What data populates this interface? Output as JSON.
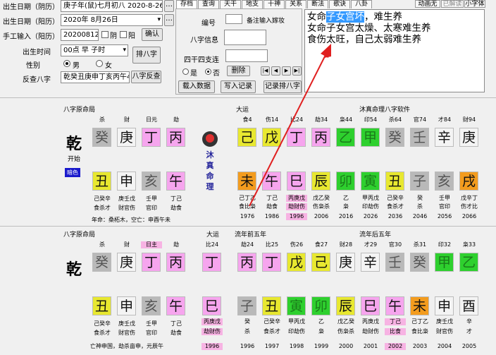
{
  "top_left": {
    "date1": {
      "label": "出生日期（阴历）",
      "value": "庚子年(鼠)七月初八 2020-8-26"
    },
    "date2": {
      "label": "出生日期（阳历）",
      "value": "2020年 8月26日"
    },
    "manual": {
      "label": "手工输入（阳历）",
      "value": "20200812",
      "c1": "阴",
      "c2": "阳",
      "confirm": "确认"
    },
    "time": {
      "label": "出生时间",
      "value": "00点  早 子时",
      "button": "排八字"
    },
    "gender": {
      "label": "性别",
      "male": "男",
      "female": "女"
    },
    "reverse": {
      "label": "反查八字",
      "value": "乾癸丑庚申丁亥丙午4",
      "button": "八字反查"
    }
  },
  "tabs": [
    "存档",
    "查询",
    "天干",
    "地支",
    "十神",
    "关系",
    "断法",
    "歌诀",
    "八卦",
    "动画无",
    "已解读",
    "小字体"
  ],
  "archive": {
    "num_label": "编号",
    "num_note": "备注输入嫁妆",
    "info_label": "八字信息",
    "sizhu_label": "四干四支连",
    "radio_yes": "是",
    "radio_no": "否",
    "delete": "删除",
    "nav": [
      "|◀",
      "◀",
      "▶",
      "▶|"
    ],
    "load": "载入数据",
    "write": "写入记录",
    "record": "记录排八字"
  },
  "text": {
    "line1a": "女命",
    "line1b": "子女宫坏",
    "line1c": "，难生养",
    "line2": "女命子女宫太燥、太寒难生养",
    "line3": "食伤太旺，自己太弱难生养"
  },
  "upper": {
    "title": "八字原命局",
    "qian": "乾",
    "start": "开始",
    "color_label": "暗色",
    "gods": [
      "杀",
      "财",
      "日元",
      "劫"
    ],
    "stems": [
      "癸",
      "庚",
      "丁",
      "丙"
    ],
    "branches": [
      "丑",
      "申",
      "亥",
      "午"
    ],
    "hidden": [
      "己癸辛",
      "庚壬戊",
      "壬甲",
      "丁己"
    ],
    "hidden_gods": [
      "食杀才",
      "财官伤",
      "官印",
      "劫食"
    ],
    "nayin": "年命：桑柘木，空亡：申酉午未",
    "logo": [
      "沐",
      "真",
      "命",
      "理"
    ],
    "dayun_label": "大运",
    "dy_gods": [
      "食4",
      "伤14",
      "比24",
      "劫34",
      "枭44",
      "印54",
      "杀64",
      "官74",
      "才84",
      "财94"
    ],
    "dy_stems": [
      "己",
      "戊",
      "丁",
      "丙",
      "乙",
      "甲",
      "癸",
      "壬",
      "辛",
      "庚"
    ],
    "dy_branches": [
      "未",
      "午",
      "巳",
      "辰",
      "卯",
      "寅",
      "丑",
      "子",
      "亥",
      "戌"
    ],
    "dy_hidden": [
      "己丁乙",
      "丁己",
      "丙庚戊",
      "戊乙癸",
      "乙",
      "甲丙戊",
      "己癸辛",
      "癸",
      "壬甲",
      "戊辛丁"
    ],
    "dy_hgods": [
      "食比枭",
      "劫食",
      "劫财伤",
      "伤枭杀",
      "枭",
      "印劫伤",
      "食杀才",
      "杀",
      "官印",
      "伤才比"
    ],
    "dy_years": [
      "1976",
      "1986",
      "1996",
      "2006",
      "2016",
      "2026",
      "2036",
      "2046",
      "2056",
      "2066"
    ],
    "software": "沐真命理八字软件"
  },
  "lower": {
    "title": "八字原命局",
    "qian": "乾",
    "gods": [
      "杀",
      "财",
      "日主",
      "劫"
    ],
    "stems": [
      "癸",
      "庚",
      "丁",
      "丙"
    ],
    "branches": [
      "丑",
      "申",
      "亥",
      "午"
    ],
    "hidden": [
      "己癸辛",
      "庚壬戊",
      "壬甲",
      "丁己"
    ],
    "hidden_gods": [
      "食杀才",
      "财官伤",
      "官印",
      "劫食"
    ],
    "note": "亡神申国，劫杀亩申，元辰午",
    "dayun_label": "大运",
    "dy_god": "比24",
    "dy_stem": "丁",
    "dy_branch": "巳",
    "dy_hidden": "丙庚戊",
    "dy_hgods": "劫财伤",
    "dy_year": "1996",
    "ln1_label": "流年前五年",
    "ln1_gods": [
      "劫24",
      "比25",
      "伤26",
      "食27",
      "财28"
    ],
    "ln1_stems": [
      "丙",
      "丁",
      "戊",
      "己",
      "庚"
    ],
    "ln1_branches": [
      "子",
      "丑",
      "寅",
      "卯",
      "辰"
    ],
    "ln1_hidden": [
      "癸",
      "己癸辛",
      "甲丙戊",
      "乙",
      "戊乙癸"
    ],
    "ln1_hgods": [
      "杀",
      "食杀才",
      "印劫伤",
      "枭",
      "伤枭杀"
    ],
    "ln1_years": [
      "1996",
      "1997",
      "1998",
      "1999",
      "2000"
    ],
    "ln2_label": "流年后五年",
    "ln2_gods": [
      "才29",
      "官30",
      "杀31",
      "印32",
      "枭33"
    ],
    "ln2_stems": [
      "辛",
      "壬",
      "癸",
      "甲",
      "乙"
    ],
    "ln2_branches": [
      "巳",
      "午",
      "未",
      "申",
      "酉"
    ],
    "ln2_hidden": [
      "丙庚戊",
      "丁己",
      "己丁乙",
      "庚壬戊",
      "辛"
    ],
    "ln2_hgods": [
      "劫财伤",
      "比食",
      "食比枭",
      "财官伤",
      "才"
    ],
    "ln2_years": [
      "2001",
      "2002",
      "2003",
      "2004",
      "2005"
    ]
  },
  "colors": {
    "earth": "#e8e830",
    "fire": "#f6a5ee",
    "water": "#b9b9b9",
    "metal": "#f4f4f4",
    "wood": "#2ed02e",
    "orange": "#f39c1e",
    "pink": "#f7b3e3",
    "select": "#3399ff",
    "arrow": "#e02020"
  }
}
